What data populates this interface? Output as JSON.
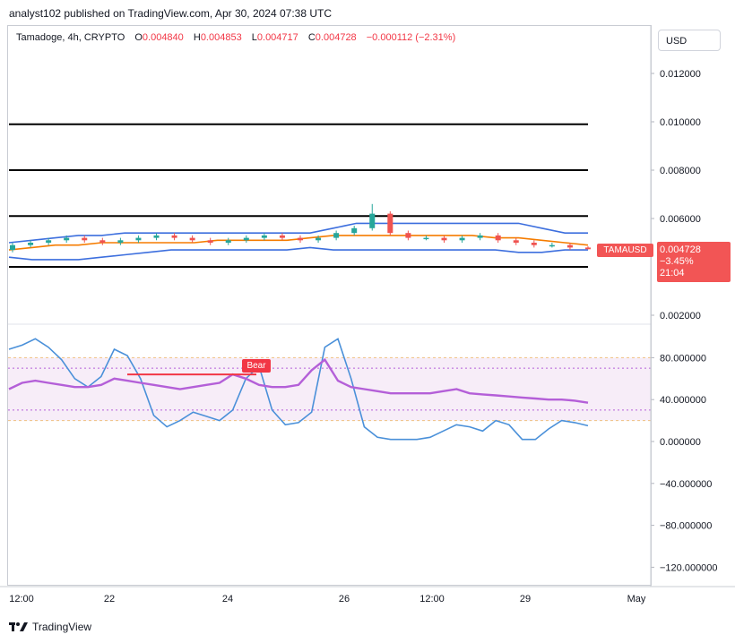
{
  "header": {
    "publisher": "analyst102 published on TradingView.com, Apr 30, 2024 07:38 UTC"
  },
  "legend": {
    "symbol": "Tamadoge, 4h, CRYPTO",
    "open_label": "O",
    "open": "0.004840",
    "high_label": "H",
    "high": "0.004853",
    "low_label": "L",
    "low": "0.004717",
    "close_label": "C",
    "close": "0.004728",
    "change": "−0.000112 (−2.31%)"
  },
  "currency": "USD",
  "price_tag": {
    "symbol": "TAMAUSD",
    "price": "0.004728",
    "change": "−3.45%",
    "countdown": "21:04"
  },
  "stoch_tag": "Bear",
  "footer": {
    "logo_text": "TradingView"
  },
  "colors": {
    "up": "#26a69a",
    "down": "#ef5350",
    "band": "#3d6fde",
    "basis": "#f57c00",
    "k": "#4a90d9",
    "rsi": "#b45fd8",
    "levels": "#000000"
  },
  "chart_data": [
    {
      "type": "candlestick",
      "title": "Tamadoge, 4h, CRYPTO",
      "y_ticks": [
        "0.012000",
        "0.010000",
        "0.008000",
        "0.006000",
        "0.002000"
      ],
      "x_ticks": [
        "12:00",
        "22",
        "24",
        "26",
        "12:00",
        "29",
        "May"
      ],
      "horizontal_levels": [
        0.0099,
        0.008,
        0.0061,
        0.004
      ],
      "series": [
        {
          "name": "upper-band",
          "values": [
            0.005,
            0.0051,
            0.0052,
            0.0053,
            0.0053,
            0.0054,
            0.0054,
            0.0054,
            0.0054,
            0.0054,
            0.0054,
            0.0054,
            0.0054,
            0.0054,
            0.0056,
            0.0058,
            0.0058,
            0.0058,
            0.0058,
            0.0058,
            0.0058,
            0.0058,
            0.0058,
            0.0056,
            0.0054,
            0.0054
          ]
        },
        {
          "name": "basis",
          "values": [
            0.0047,
            0.0048,
            0.0049,
            0.0049,
            0.005,
            0.005,
            0.005,
            0.005,
            0.005,
            0.0051,
            0.0051,
            0.0051,
            0.0051,
            0.0052,
            0.0053,
            0.0053,
            0.0053,
            0.0053,
            0.0053,
            0.0053,
            0.0053,
            0.0052,
            0.0052,
            0.0051,
            0.005,
            0.0049
          ]
        },
        {
          "name": "lower-band",
          "values": [
            0.0044,
            0.0043,
            0.0043,
            0.0043,
            0.0044,
            0.0045,
            0.0046,
            0.0047,
            0.0047,
            0.0047,
            0.0047,
            0.0047,
            0.0047,
            0.0048,
            0.0047,
            0.0047,
            0.0047,
            0.0047,
            0.0047,
            0.0047,
            0.0047,
            0.0047,
            0.0046,
            0.0046,
            0.0047,
            0.0047
          ]
        }
      ],
      "candles": [
        [
          0.0047,
          0.0049,
          0.005,
          0.0046
        ],
        [
          0.0049,
          0.005,
          0.0051,
          0.0048
        ],
        [
          0.005,
          0.0051,
          0.0052,
          0.0049
        ],
        [
          0.0051,
          0.0052,
          0.0053,
          0.005
        ],
        [
          0.0052,
          0.0051,
          0.0053,
          0.005
        ],
        [
          0.0051,
          0.005,
          0.0052,
          0.0049
        ],
        [
          0.005,
          0.0051,
          0.0052,
          0.0049
        ],
        [
          0.0051,
          0.0052,
          0.0053,
          0.005
        ],
        [
          0.0052,
          0.0053,
          0.0054,
          0.0051
        ],
        [
          0.0053,
          0.0052,
          0.0054,
          0.0051
        ],
        [
          0.0052,
          0.0051,
          0.0053,
          0.005
        ],
        [
          0.0051,
          0.005,
          0.0052,
          0.0049
        ],
        [
          0.005,
          0.0051,
          0.0052,
          0.0049
        ],
        [
          0.0051,
          0.0052,
          0.0053,
          0.005
        ],
        [
          0.0052,
          0.0053,
          0.0054,
          0.0051
        ],
        [
          0.0053,
          0.0052,
          0.0054,
          0.0051
        ],
        [
          0.0052,
          0.0051,
          0.0053,
          0.005
        ],
        [
          0.0051,
          0.0052,
          0.0053,
          0.005
        ],
        [
          0.0052,
          0.0054,
          0.0055,
          0.0051
        ],
        [
          0.0054,
          0.0056,
          0.0057,
          0.0053
        ],
        [
          0.0056,
          0.0062,
          0.0066,
          0.0055
        ],
        [
          0.0062,
          0.0054,
          0.0063,
          0.0053
        ],
        [
          0.0054,
          0.0052,
          0.0055,
          0.0051
        ],
        [
          0.0052,
          0.0052,
          0.0053,
          0.0051
        ],
        [
          0.0052,
          0.0051,
          0.0053,
          0.005
        ],
        [
          0.0051,
          0.0052,
          0.0053,
          0.005
        ],
        [
          0.0052,
          0.0053,
          0.0054,
          0.0051
        ],
        [
          0.0053,
          0.0051,
          0.0054,
          0.005
        ],
        [
          0.0051,
          0.005,
          0.0052,
          0.0049
        ],
        [
          0.005,
          0.0049,
          0.0051,
          0.0048
        ],
        [
          0.0049,
          0.0049,
          0.005,
          0.0048
        ],
        [
          0.0049,
          0.0048,
          0.005,
          0.0047
        ],
        [
          0.0048,
          0.00473,
          0.00485,
          0.00472
        ]
      ]
    },
    {
      "type": "line",
      "y_ticks": [
        "80.000000",
        "40.000000",
        "0.000000",
        "−40.000000",
        "−80.000000",
        "−120.000000"
      ],
      "levels": [
        80,
        70,
        30,
        20
      ],
      "series": [
        {
          "name": "stoch-k",
          "values": [
            88,
            92,
            98,
            90,
            78,
            60,
            52,
            62,
            88,
            82,
            60,
            25,
            14,
            20,
            28,
            24,
            20,
            30,
            60,
            72,
            30,
            16,
            18,
            28,
            90,
            98,
            60,
            14,
            4,
            2,
            2,
            2,
            4,
            10,
            16,
            14,
            10,
            20,
            16,
            2,
            2,
            12,
            20,
            18,
            15
          ]
        },
        {
          "name": "rsi",
          "values": [
            50,
            56,
            58,
            56,
            54,
            52,
            52,
            54,
            60,
            58,
            56,
            54,
            52,
            50,
            52,
            54,
            56,
            64,
            60,
            54,
            52,
            52,
            54,
            68,
            78,
            58,
            52,
            50,
            48,
            46,
            46,
            46,
            46,
            48,
            50,
            46,
            45,
            44,
            43,
            42,
            41,
            40,
            40,
            39,
            37
          ]
        }
      ]
    }
  ]
}
